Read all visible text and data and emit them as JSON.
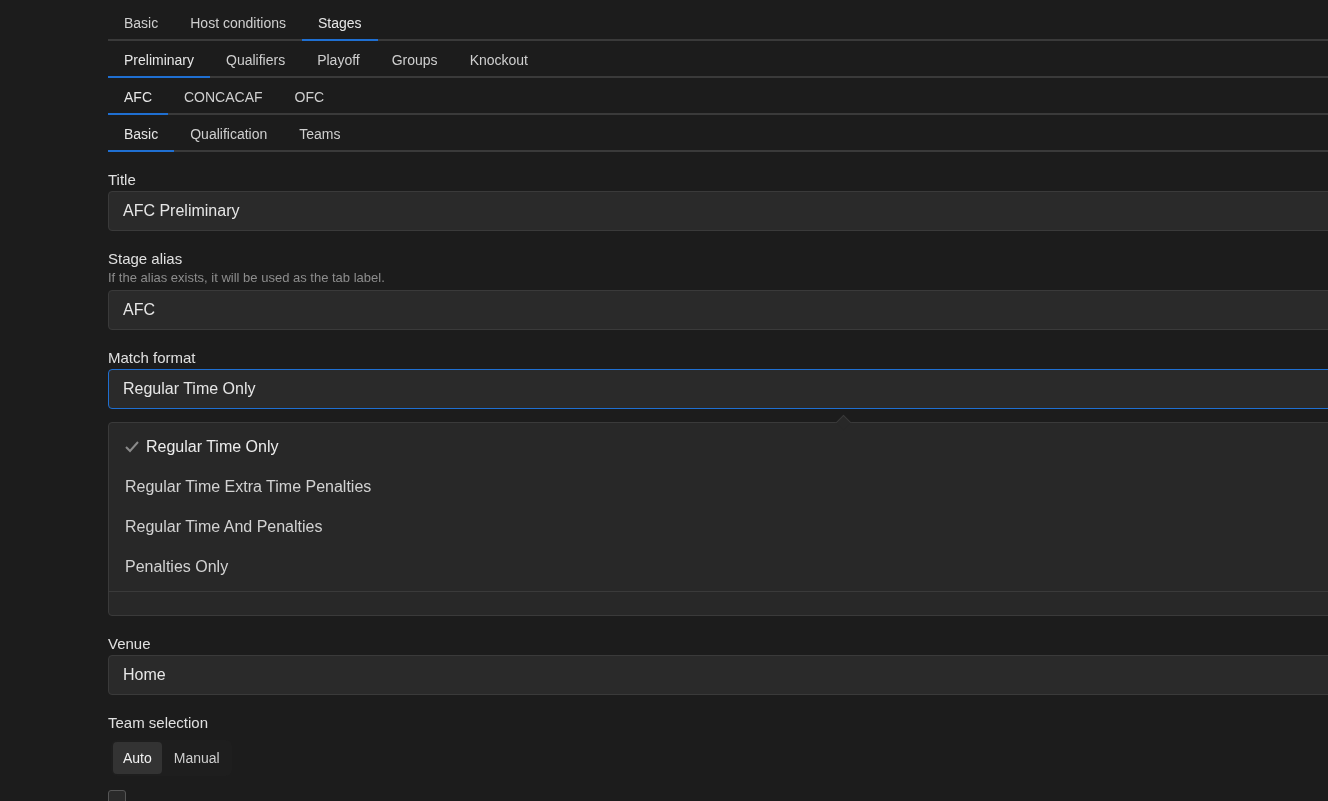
{
  "tab_rows": [
    [
      {
        "label": "Basic",
        "selected": false
      },
      {
        "label": "Host conditions",
        "selected": false
      },
      {
        "label": "Stages",
        "selected": true
      }
    ],
    [
      {
        "label": "Preliminary",
        "selected": true
      },
      {
        "label": "Qualifiers",
        "selected": false
      },
      {
        "label": "Playoff",
        "selected": false
      },
      {
        "label": "Groups",
        "selected": false
      },
      {
        "label": "Knockout",
        "selected": false
      }
    ],
    [
      {
        "label": "AFC",
        "selected": true
      },
      {
        "label": "CONCACAF",
        "selected": false
      },
      {
        "label": "OFC",
        "selected": false
      }
    ],
    [
      {
        "label": "Basic",
        "selected": true
      },
      {
        "label": "Qualification",
        "selected": false
      },
      {
        "label": "Teams",
        "selected": false
      }
    ]
  ],
  "title_field": {
    "label": "Title",
    "value": "AFC Preliminary"
  },
  "alias_field": {
    "label": "Stage alias",
    "hint": "If the alias exists, it will be used as the tab label.",
    "value": "AFC"
  },
  "match_format": {
    "label": "Match format",
    "value": "Regular Time Only",
    "expanded": true,
    "options": [
      {
        "label": "Regular Time Only",
        "selected": true
      },
      {
        "label": "Regular Time Extra Time Penalties",
        "selected": false
      },
      {
        "label": "Regular Time And Penalties",
        "selected": false
      },
      {
        "label": "Penalties Only",
        "selected": false
      }
    ]
  },
  "venue_field": {
    "label": "Venue",
    "value": "Home"
  },
  "team_selection": {
    "label": "Team selection",
    "options": [
      {
        "label": "Auto",
        "selected": true
      },
      {
        "label": "Manual",
        "selected": false
      }
    ]
  },
  "checkbox": {
    "checked": false
  }
}
